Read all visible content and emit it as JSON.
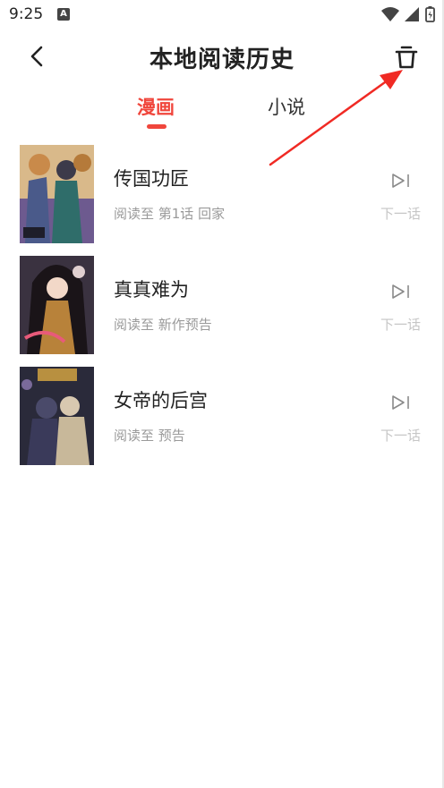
{
  "status": {
    "time": "9:25",
    "notification_icon": "A"
  },
  "header": {
    "title": "本地阅读历史",
    "back_icon": "chevron-left-icon",
    "delete_icon": "trash-icon"
  },
  "tabs": [
    {
      "label": "漫画",
      "active": true
    },
    {
      "label": "小说",
      "active": false
    }
  ],
  "items": [
    {
      "title": "传国功匠",
      "progress": "阅读至 第1话 回家",
      "next_label": "下一话"
    },
    {
      "title": "真真难为",
      "progress": "阅读至 新作预告",
      "next_label": "下一话"
    },
    {
      "title": "女帝的后宫",
      "progress": "阅读至 预告",
      "next_label": "下一话"
    }
  ],
  "colors": {
    "accent": "#f0463c",
    "arrow": "#f02a24"
  }
}
